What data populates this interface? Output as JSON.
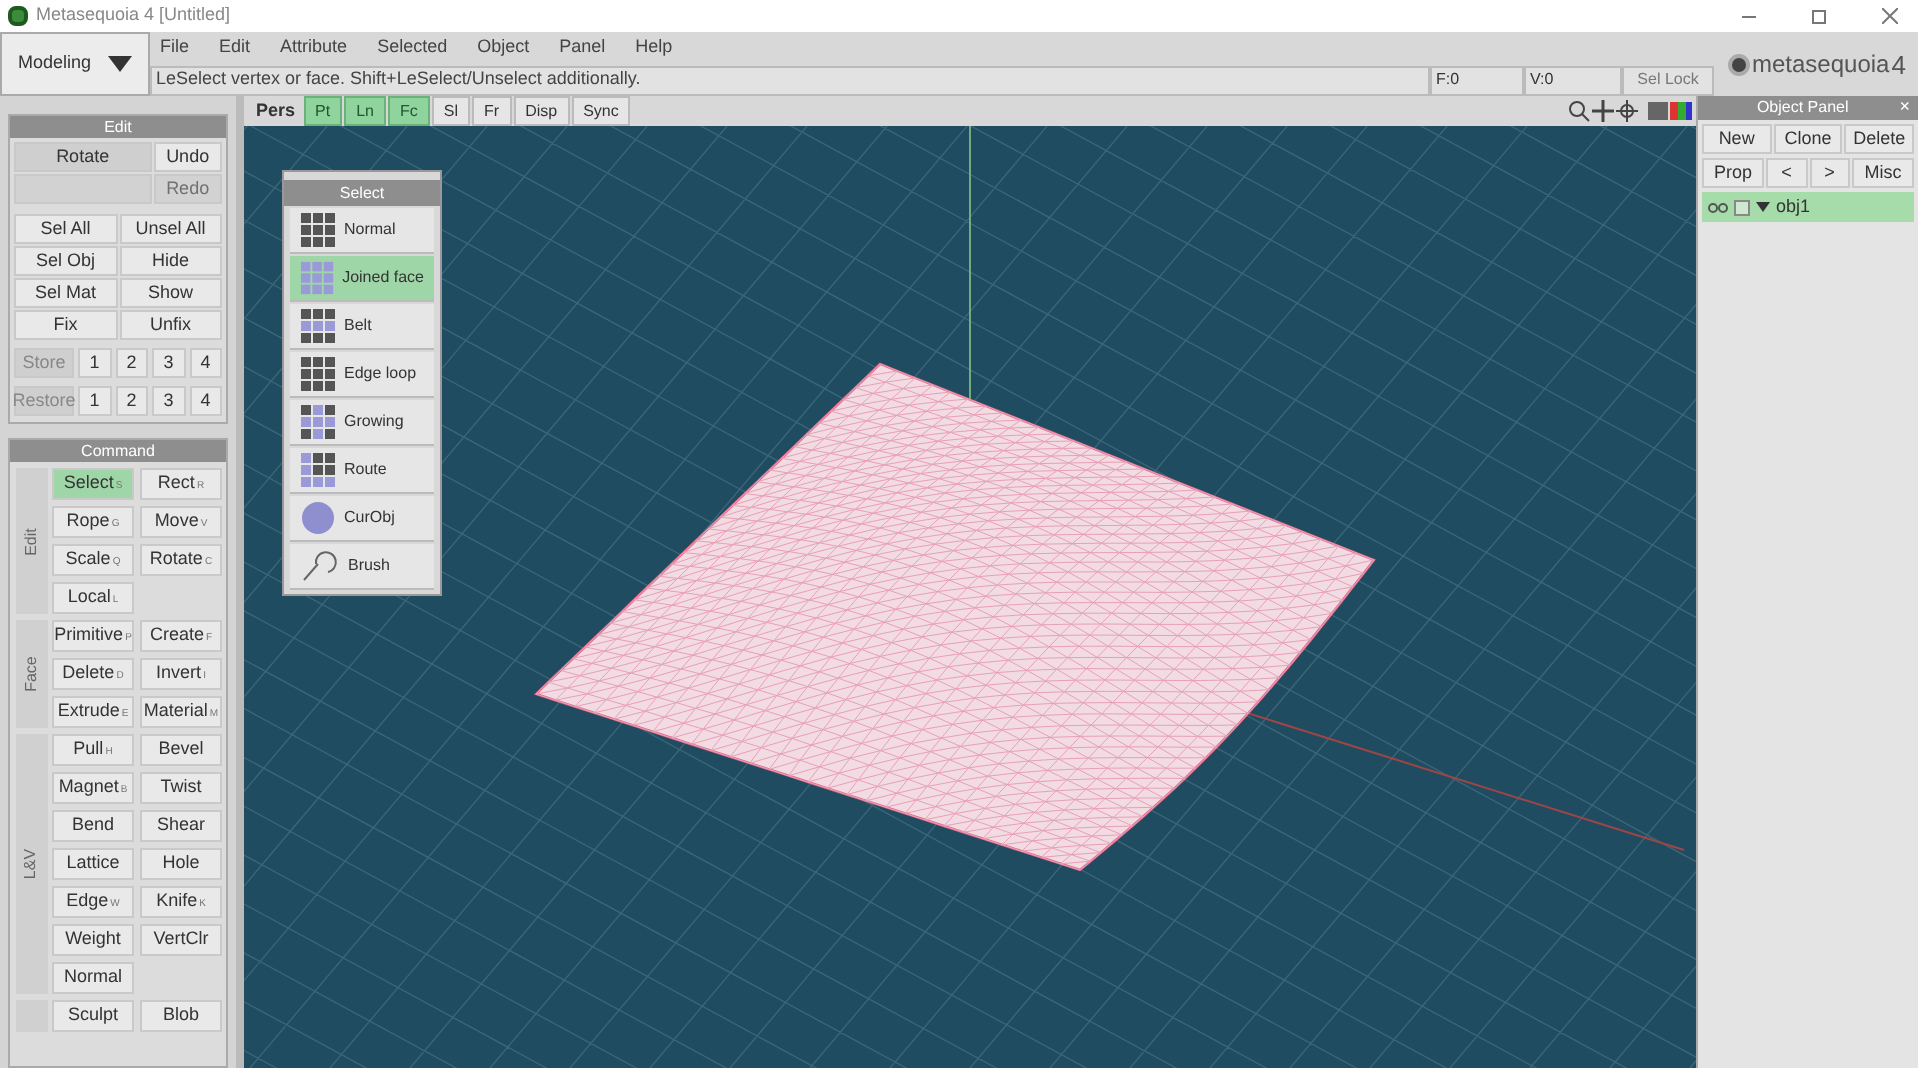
{
  "window": {
    "title": "Metasequoia 4 [Untitled]"
  },
  "mode_dropdown": {
    "value": "Modeling"
  },
  "menu": [
    "File",
    "Edit",
    "Attribute",
    "Selected",
    "Object",
    "Panel",
    "Help"
  ],
  "status_bar": {
    "message": "LeSelect vertex or face.  Shift+LeSelect/Unselect additionally.",
    "faces": "F:0",
    "vertices": "V:0",
    "sel_lock": "Sel Lock"
  },
  "logo": {
    "text": "metasequoia",
    "version_mark": "4"
  },
  "view_toolbar": [
    {
      "label": "Pers",
      "kind": "label"
    },
    {
      "label": "Pt",
      "selected": true,
      "kind": "toggle"
    },
    {
      "label": "Ln",
      "selected": true,
      "kind": "toggle"
    },
    {
      "label": "Fc",
      "selected": true,
      "kind": "toggle"
    },
    {
      "label": "Sl",
      "selected": false,
      "kind": "toggle"
    },
    {
      "label": "Fr",
      "selected": false,
      "kind": "toggle"
    },
    {
      "label": "Disp",
      "selected": false,
      "kind": "toggle"
    },
    {
      "label": "Sync",
      "selected": false,
      "kind": "toggle"
    }
  ],
  "edit_panel": {
    "title": "Edit",
    "history": [
      {
        "label": "Rotate",
        "disabled": false
      },
      {
        "label": "Undo",
        "disabled": false
      },
      {
        "disabled": true
      },
      {
        "label": "Redo",
        "disabled": true
      }
    ],
    "buttons": [
      "Sel All",
      "Unsel All",
      "Sel Obj",
      "Hide",
      "Sel Mat",
      "Show",
      "Fix",
      "Unfix"
    ],
    "store": {
      "label": "Store",
      "slots": [
        "1",
        "2",
        "3",
        "4"
      ]
    },
    "restore": {
      "label": "Restore",
      "slots": [
        "1",
        "2",
        "3",
        "4"
      ]
    }
  },
  "command_panel": {
    "title": "Command",
    "groups": [
      {
        "label": "Edit",
        "commands": [
          {
            "label": "Select",
            "key": "S",
            "selected": true
          },
          {
            "label": "Rect",
            "key": "R",
            "selected": false
          },
          {
            "label": "Rope",
            "key": "G",
            "selected": false
          },
          {
            "label": "Move",
            "key": "V",
            "selected": false
          },
          {
            "label": "Scale",
            "key": "Q",
            "selected": false
          },
          {
            "label": "Rotate",
            "key": "C",
            "selected": false
          },
          {
            "label": "Local",
            "key": "L",
            "selected": false
          }
        ]
      },
      {
        "label": "Face",
        "commands": [
          {
            "label": "Primitive",
            "key": "P",
            "selected": false
          },
          {
            "label": "Create",
            "key": "F",
            "selected": false
          },
          {
            "label": "Delete",
            "key": "D",
            "selected": false
          },
          {
            "label": "Invert",
            "key": "I",
            "selected": false
          },
          {
            "label": "Extrude",
            "key": "E",
            "selected": false
          },
          {
            "label": "Material",
            "key": "M",
            "selected": false
          }
        ]
      },
      {
        "label": "L&V",
        "commands": [
          {
            "label": "Pull",
            "key": "H",
            "selected": false
          },
          {
            "label": "Bevel",
            "selected": false
          },
          {
            "label": "Magnet",
            "key": "B",
            "selected": false
          },
          {
            "label": "Twist",
            "selected": false
          },
          {
            "label": "Bend",
            "selected": false
          },
          {
            "label": "Shear",
            "selected": false
          },
          {
            "label": "Lattice",
            "selected": false
          },
          {
            "label": "Hole",
            "selected": false
          },
          {
            "label": "Edge",
            "key": "W",
            "selected": false
          },
          {
            "label": "Knife",
            "key": "K",
            "selected": false
          },
          {
            "label": "Weight",
            "selected": false
          },
          {
            "label": "VertClr",
            "selected": false
          },
          {
            "label": "Normal",
            "selected": false
          }
        ]
      },
      {
        "commands": [
          {
            "label": "Sculpt",
            "selected": false
          },
          {
            "label": "Blob",
            "selected": false
          }
        ]
      }
    ]
  },
  "select_panel": {
    "title": "Select",
    "items": [
      {
        "label": "Normal",
        "kind": "grid",
        "selected": false
      },
      {
        "label": "Joined face",
        "kind": "joined",
        "selected": true
      },
      {
        "label": "Belt",
        "kind": "belt",
        "selected": false
      },
      {
        "label": "Edge loop",
        "kind": "grid",
        "selected": false
      },
      {
        "label": "Growing",
        "kind": "growing",
        "selected": false
      },
      {
        "label": "Route",
        "kind": "route",
        "selected": false
      },
      {
        "label": "CurObj",
        "kind": "circle",
        "selected": false
      },
      {
        "label": "Brush",
        "kind": "brush",
        "selected": false
      }
    ]
  },
  "object_panel": {
    "title": "Object Panel",
    "close": "×",
    "buttons": [
      "New",
      "Clone",
      "Delete",
      "Prop",
      "<",
      ">",
      "Misc"
    ],
    "objects": [
      {
        "name": "obj1",
        "visible": true,
        "locked": false,
        "expanded": true,
        "selected": true
      }
    ]
  }
}
